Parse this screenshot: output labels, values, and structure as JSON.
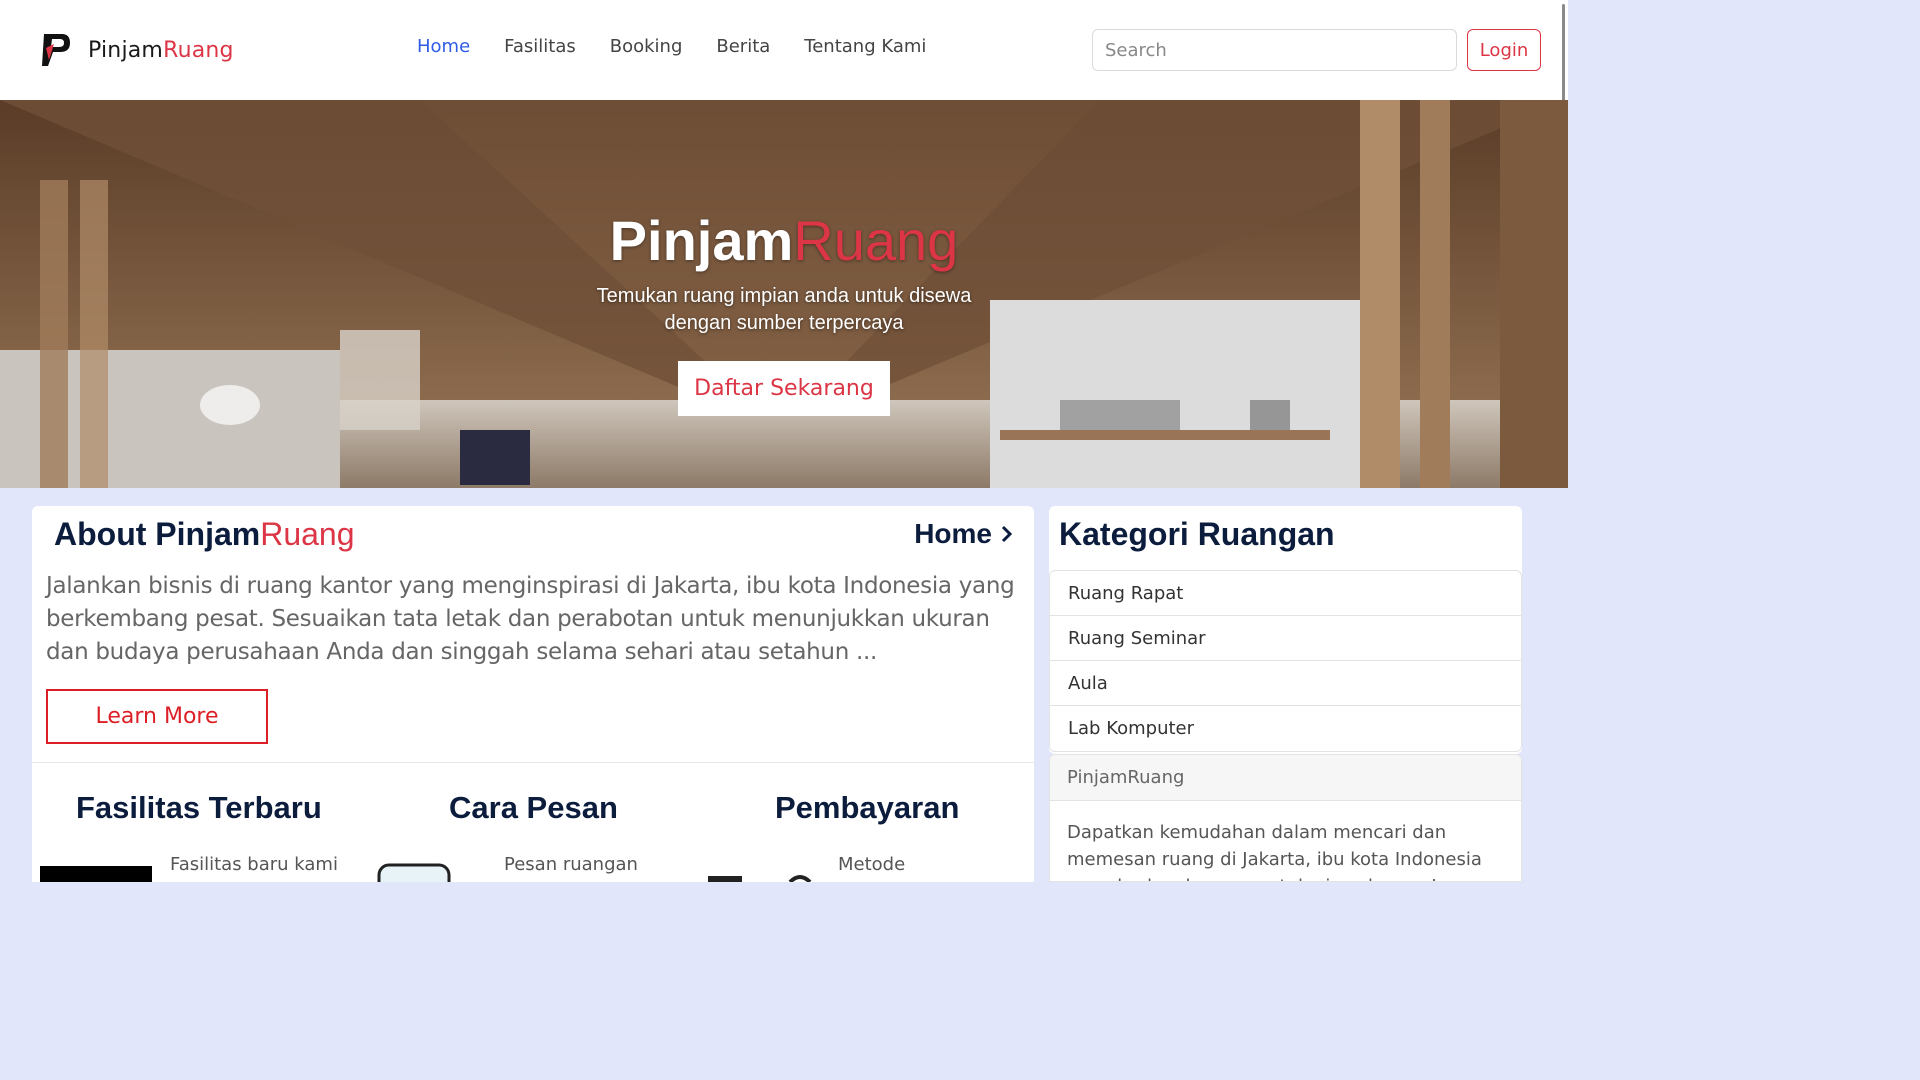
{
  "navbar": {
    "brand_primary": "Pinjam",
    "brand_accent": "Ruang",
    "links": [
      {
        "label": "Home",
        "active": true
      },
      {
        "label": "Fasilitas",
        "active": false
      },
      {
        "label": "Booking",
        "active": false
      },
      {
        "label": "Berita",
        "active": false
      },
      {
        "label": "Tentang Kami",
        "active": false
      }
    ],
    "search_placeholder": "Search",
    "login_label": "Login"
  },
  "hero": {
    "title_primary": "Pinjam",
    "title_accent": "Ruang",
    "subtitle": "Temukan ruang impian anda untuk disewa dengan sumber terpercaya",
    "cta_label": "Daftar Sekarang"
  },
  "about": {
    "title_primary": "About Pinjam",
    "title_accent": "Ruang",
    "breadcrumb": "Home",
    "text": "Jalankan bisnis di ruang kantor yang menginspirasi di Jakarta, ibu kota Indonesia yang berkembang pesat. Sesuaikan tata letak dan perabotan untuk menunjukkan ukuran dan budaya perusahaan Anda dan singgah selama sehari atau setahun ...",
    "learn_more": "Learn More",
    "columns": [
      {
        "title": "Fasilitas Terbaru",
        "text": "Fasilitas  baru kami",
        "icon": "building-icon"
      },
      {
        "title": "Cara Pesan",
        "text": "Pesan         ruangan",
        "icon": "phone-icon"
      },
      {
        "title": "Pembayaran",
        "text": "Metode",
        "icon": "payment-icon"
      }
    ]
  },
  "kategori": {
    "title": "Kategori Ruangan",
    "items": [
      "Ruang Rapat",
      "Ruang Seminar",
      "Aula",
      "Lab Komputer"
    ]
  },
  "info": {
    "heading": "PinjamRuang",
    "body": "Dapatkan kemudahan dalam mencari dan memesan ruang di Jakarta, ibu kota Indonesia yang berkembang pesat, login sekarang!"
  },
  "colors": {
    "accent": "#dc3545",
    "nav_active": "#2f5ce6",
    "heading": "#0c1c3d",
    "page_bg": "#e2e6fb"
  }
}
